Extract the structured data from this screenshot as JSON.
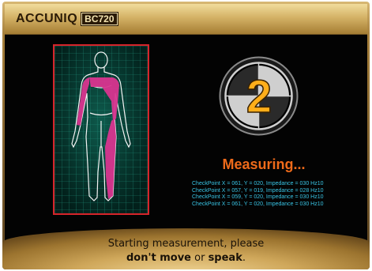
{
  "header": {
    "brand_name": "ACCUNIQ",
    "model": "BC720"
  },
  "countdown": {
    "digit": "2",
    "accent": "#ffae1a"
  },
  "status": {
    "title": "Measuring...",
    "color": "#ee6a1a"
  },
  "checkpoints": [
    "CheckPoint X = 061, Y = 020, Impedance = 030 Hz10",
    "CheckPoint X = 057, Y = 019, Impedance = 028 Hz10",
    "CheckPoint X = 059, Y = 020, Impedance = 030 Hz10",
    "CheckPoint X = 061, Y = 020, Impedance = 030 Hz10"
  ],
  "instruction": {
    "line1": "Starting measurement, please",
    "part_dont_move": "don't move",
    "part_or": " or ",
    "part_speak": "speak",
    "part_end": "."
  },
  "body_figure": {
    "highlight_color": "#d9358f",
    "grid_color": "#1f8c78",
    "border_color": "#d6242a"
  }
}
